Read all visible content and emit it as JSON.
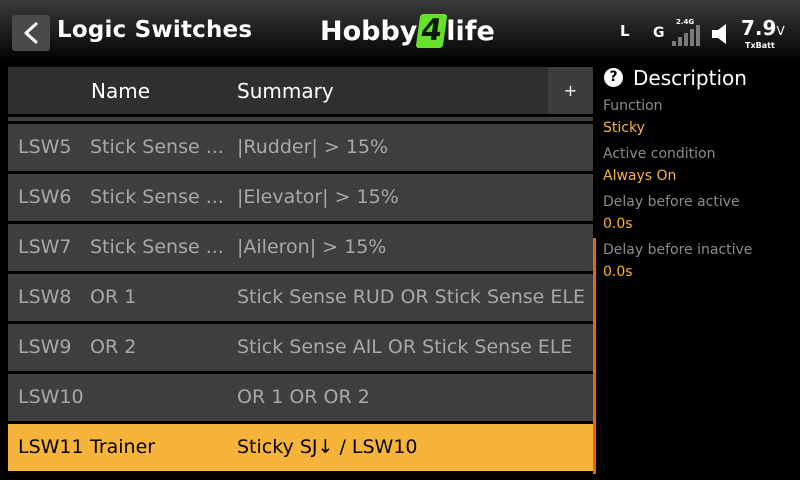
{
  "header": {
    "title": "Logic Switches",
    "logo_left": "Hobby",
    "logo_mid": "4",
    "logo_right": "life",
    "status_l": "L",
    "status_g": "G",
    "signal_band": "2.4G",
    "battery_voltage": "7.9",
    "battery_unit": "V",
    "battery_label": "TxBatt",
    "icons": [
      "back-arrow-icon",
      "signal-bars-icon",
      "speaker-icon"
    ]
  },
  "table": {
    "columns": {
      "name": "Name",
      "summary": "Summary",
      "add": "+"
    },
    "rows": [
      {
        "id": "LSW5",
        "name": "Stick Sense ...",
        "summary": "|Rudder| > 15%"
      },
      {
        "id": "LSW6",
        "name": "Stick Sense ...",
        "summary": "|Elevator| > 15%"
      },
      {
        "id": "LSW7",
        "name": "Stick Sense ...",
        "summary": "|Aileron| > 15%"
      },
      {
        "id": "LSW8",
        "name": "OR 1",
        "summary": "Stick Sense RUD OR Stick Sense ELE"
      },
      {
        "id": "LSW9",
        "name": "OR 2",
        "summary": "Stick Sense AIL OR Stick Sense ELE"
      },
      {
        "id": "LSW10",
        "name": "",
        "summary": "OR 1 OR OR 2"
      },
      {
        "id": "LSW11",
        "name": "Trainer",
        "summary": "Sticky SJ↓ / LSW10"
      }
    ],
    "selected_row": "LSW11"
  },
  "description": {
    "title": "Description",
    "help_symbol": "?",
    "function_label": "Function",
    "function_value": "Sticky",
    "active_condition_label": "Active condition",
    "active_condition_value": "Always On",
    "delay_active_label": "Delay before active",
    "delay_active_value": "0.0s",
    "delay_inactive_label": "Delay before inactive",
    "delay_inactive_value": "0.0s"
  },
  "colors": {
    "accent": "#f7b43a",
    "scrollbar": "#e26a00",
    "logo_green": "#69e02a",
    "row_bg": "#3e3e3e",
    "header_row_bg": "#2f2f2f"
  }
}
